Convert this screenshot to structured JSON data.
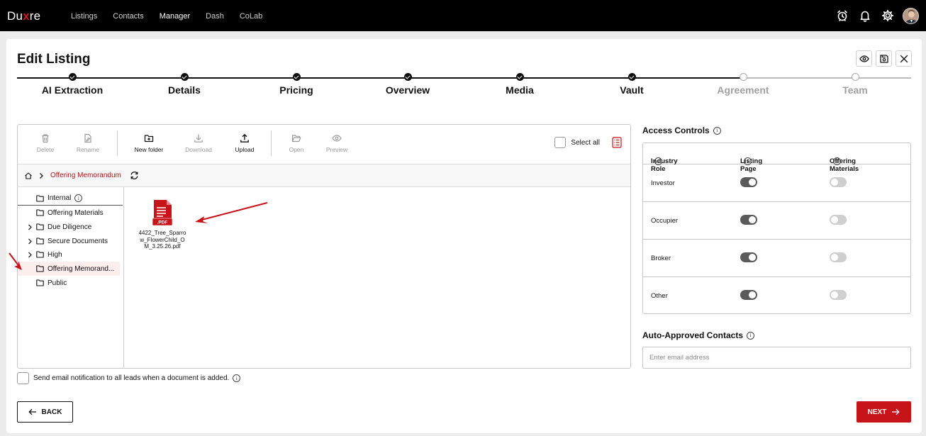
{
  "app": {
    "logo_left": "Du",
    "logo_x": "x",
    "logo_right": "re"
  },
  "nav": {
    "items": [
      "Listings",
      "Contacts",
      "Manager",
      "Dash",
      "CoLab"
    ],
    "active": "Manager"
  },
  "page": {
    "title": "Edit Listing"
  },
  "steps": [
    {
      "label": "AI Extraction",
      "done": true
    },
    {
      "label": "Details",
      "done": true
    },
    {
      "label": "Pricing",
      "done": true
    },
    {
      "label": "Overview",
      "done": true
    },
    {
      "label": "Media",
      "done": true
    },
    {
      "label": "Vault",
      "done": true
    },
    {
      "label": "Agreement",
      "done": false
    },
    {
      "label": "Team",
      "done": false
    }
  ],
  "toolbar": {
    "delete": "Delete",
    "rename": "Rename",
    "new_folder": "New folder",
    "download": "Download",
    "upload": "Upload",
    "open": "Open",
    "preview": "Preview",
    "select_all": "Select all"
  },
  "breadcrumb": {
    "current": "Offering Memorandum"
  },
  "tree": [
    {
      "label": "Internal",
      "has_children": false,
      "info": true
    },
    {
      "label": "Offering Materials",
      "has_children": false
    },
    {
      "label": "Due Diligence",
      "has_children": true
    },
    {
      "label": "Secure Documents",
      "has_children": true
    },
    {
      "label": "High",
      "has_children": true
    },
    {
      "label": "Offering Memorand...",
      "has_children": false,
      "selected": true
    },
    {
      "label": "Public",
      "has_children": false
    }
  ],
  "file": {
    "badge": ".PDF",
    "name": "4422_Tree_Sparrow_FlowerChild_OM_3.25.26.pdf"
  },
  "notify": {
    "label": "Send email notification to all leads when a document is added."
  },
  "access": {
    "title": "Access Controls",
    "headers": [
      "Industry Role",
      "Listing Page",
      "Offering Materials"
    ],
    "rows": [
      {
        "role": "Investor",
        "listing": true,
        "offering": false
      },
      {
        "role": "Occupier",
        "listing": true,
        "offering": false
      },
      {
        "role": "Broker",
        "listing": true,
        "offering": false
      },
      {
        "role": "Other",
        "listing": true,
        "offering": false
      }
    ]
  },
  "auto": {
    "title": "Auto-Approved Contacts",
    "placeholder": "Enter email address"
  },
  "buttons": {
    "back": "BACK",
    "next": "NEXT"
  },
  "colors": {
    "accent": "#c7141b",
    "link": "#b4141b",
    "toggle_on": "#5a5a5a",
    "toggle_off": "#cfcfcf"
  }
}
